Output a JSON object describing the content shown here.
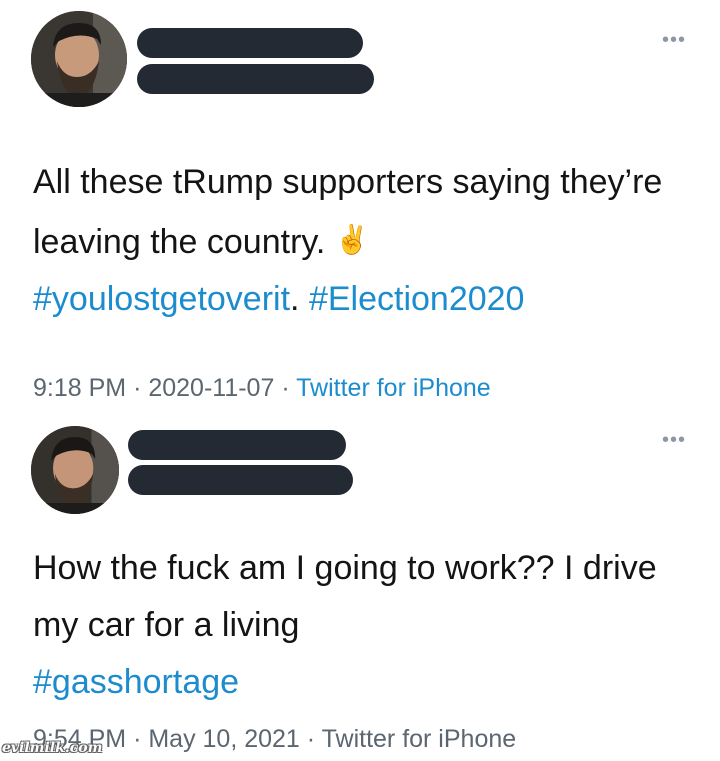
{
  "tweets": [
    {
      "text_plain": "All these tRump supporters saying they’re leaving the country.",
      "emoji": "✌️",
      "hashtags": [
        "#youlostgetoverit",
        "#Election2020"
      ],
      "hashtag_separator": ".",
      "time": "9:18 PM",
      "date": "2020-11-07",
      "source": "Twitter for iPhone",
      "more_label": "•••"
    },
    {
      "text_plain": "How the fuck am I going to work?? I drive my car for a living",
      "hashtags": [
        "#gasshortage"
      ],
      "time": "9:54 PM",
      "date": "May 10, 2021",
      "source": "Twitter for iPhone",
      "more_label": "•••"
    }
  ],
  "separator": "·",
  "watermark": "evilmilk.com",
  "colors": {
    "hashtag": "#1d8ccf",
    "meta_text": "#5b6670",
    "redaction_bar": "#242a33",
    "body_text": "#141414"
  }
}
